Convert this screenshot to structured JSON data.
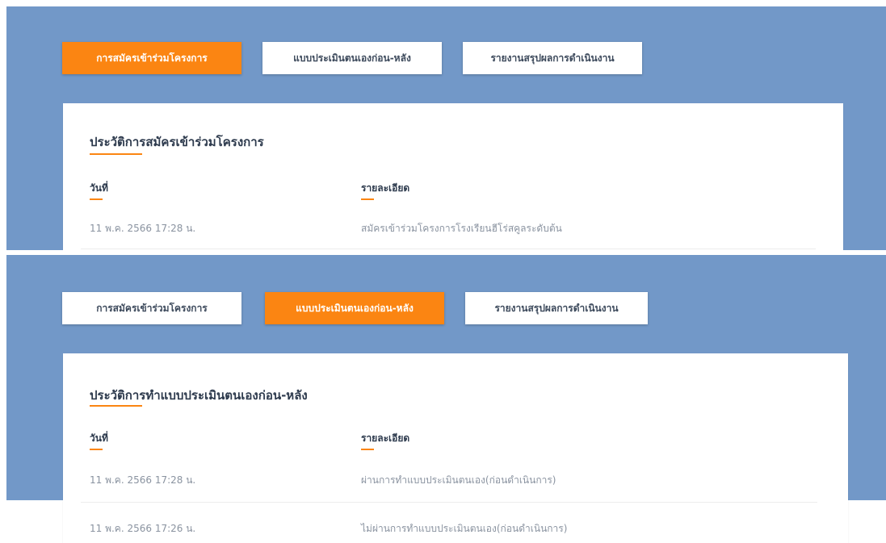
{
  "tabs": {
    "register": "การสมัครเข้าร่วมโครงการ",
    "self_assessment": "แบบประเมินตนเองก่อน-หลัง",
    "report": "รายงานสรุปผลการดำเนินงาน"
  },
  "colors": {
    "background_blue": "#7298c8",
    "accent_orange": "#fb8512"
  },
  "panel_register": {
    "active_tab": "register",
    "title": "ประวัติการสมัครเข้าร่วมโครงการ",
    "columns": {
      "date": "วันที่",
      "detail": "รายละเอียด"
    },
    "rows": [
      {
        "date": "11 พ.ค. 2566 17:28 น.",
        "detail": "สมัครเข้าร่วมโครงการโรงเรียนฮีโร่สคูลระดับต้น"
      }
    ]
  },
  "panel_assessment": {
    "active_tab": "self_assessment",
    "title": "ประวัติการทำแบบประเมินตนเองก่อน-หลัง",
    "columns": {
      "date": "วันที่",
      "detail": "รายละเอียด"
    },
    "rows": [
      {
        "date": "11 พ.ค. 2566 17:28 น.",
        "detail": "ผ่านการทำแบบประเมินตนเอง(ก่อนดำเนินการ)"
      },
      {
        "date": "11 พ.ค. 2566 17:26 น.",
        "detail": "ไม่ผ่านการทำแบบประเมินตนเอง(ก่อนดำเนินการ)"
      }
    ]
  }
}
